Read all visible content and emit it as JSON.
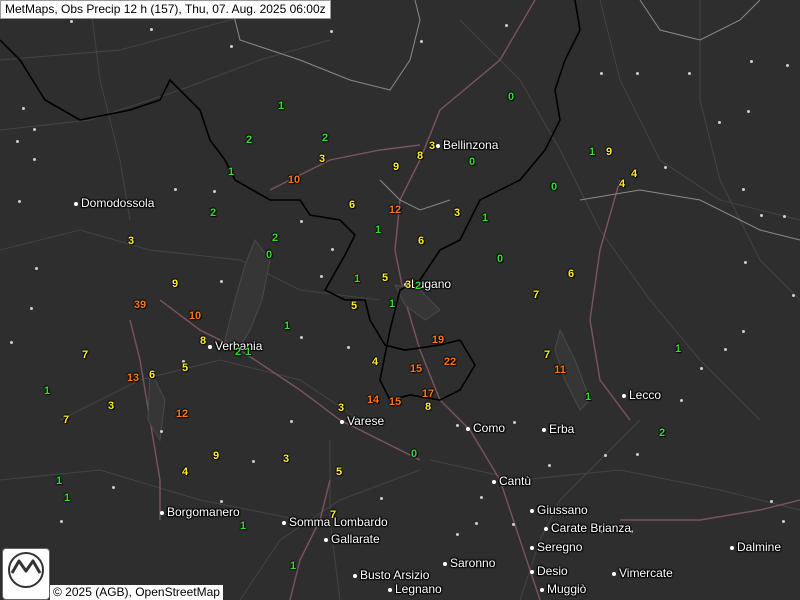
{
  "title": "MetMaps, Obs Precip 12 h (157), Thu, 07. Aug. 2025 06:00z",
  "attribution": "© 2025 (AGB), OpenStreetMap",
  "logo_text": "METMAPS",
  "colors": {
    "background": "#2e2e2e",
    "border": "#000000",
    "low": "#33dd33",
    "mid": "#ffee22",
    "high": "#ff7711"
  },
  "cities": [
    {
      "name": "Bellinzona"
    },
    {
      "name": "Domodossola"
    },
    {
      "name": "Lugano"
    },
    {
      "name": "Verbania"
    },
    {
      "name": "Lecco"
    },
    {
      "name": "Varese"
    },
    {
      "name": "Como"
    },
    {
      "name": "Erba"
    },
    {
      "name": "Cantù"
    },
    {
      "name": "Borgomanero"
    },
    {
      "name": "Somma Lombardo"
    },
    {
      "name": "Giussano"
    },
    {
      "name": "Carate Brianza"
    },
    {
      "name": "Gallarate"
    },
    {
      "name": "Seregno"
    },
    {
      "name": "Dalmine"
    },
    {
      "name": "Busto Arsizio"
    },
    {
      "name": "Saronno"
    },
    {
      "name": "Desio"
    },
    {
      "name": "Vimercate"
    },
    {
      "name": "Legnano"
    },
    {
      "name": "Muggiò"
    }
  ],
  "observations": [
    "1",
    "0",
    "2",
    "2",
    "3",
    "3",
    "1",
    "9",
    "8",
    "0",
    "10",
    "6",
    "12",
    "2",
    "3",
    "1",
    "0",
    "1",
    "9",
    "4",
    "4",
    "1",
    "2",
    "0",
    "6",
    "0",
    "3",
    "9",
    "39",
    "5",
    "1",
    "5",
    "3",
    "2",
    "7",
    "10",
    "1",
    "1",
    "8",
    "2",
    "19",
    "7",
    "1",
    "7",
    "5",
    "13",
    "6",
    "22",
    "11",
    "4",
    "15",
    "1",
    "1",
    "3",
    "7",
    "14",
    "15",
    "17",
    "8",
    "12",
    "3",
    "0",
    "1",
    "2",
    "9",
    "4",
    "5",
    "3",
    "1",
    "1",
    "6",
    "7",
    "1",
    "1"
  ]
}
